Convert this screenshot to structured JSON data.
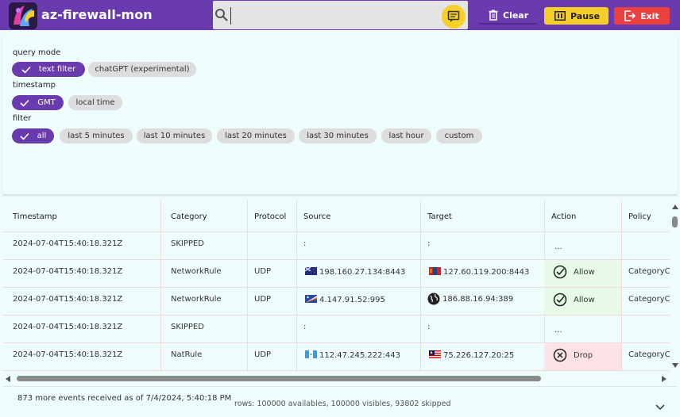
{
  "app": {
    "title": "az-firewall-mon"
  },
  "search": {
    "value": "",
    "placeholder": ""
  },
  "toolbar": {
    "clear_label": "Clear",
    "pause_label": "Pause",
    "exit_label": "Exit"
  },
  "filters": {
    "query_mode": {
      "label": "query mode",
      "options": [
        "text filter",
        "chatGPT (experimental)"
      ],
      "selected": "text filter"
    },
    "timestamp": {
      "label": "timestamp",
      "options": [
        "GMT",
        "local time"
      ],
      "selected": "GMT"
    },
    "filter": {
      "label": "filter",
      "options": [
        "all",
        "last 5 minutes",
        "last 10 minutes",
        "last 20 minutes",
        "last 30 minutes",
        "last hour",
        "custom"
      ],
      "selected": "all"
    }
  },
  "table": {
    "columns": [
      "Timestamp",
      "Category",
      "Protocol",
      "Source",
      "Target",
      "Action",
      "Policy"
    ],
    "rows": [
      {
        "timestamp": "2024-07-04T15:40:18.321Z",
        "category": "SKIPPED",
        "protocol": "",
        "source": ":",
        "source_flag": "",
        "target": ":",
        "target_flag": "",
        "action": "...",
        "action_icon": "",
        "policy": ""
      },
      {
        "timestamp": "2024-07-04T15:40:18.321Z",
        "category": "NetworkRule",
        "protocol": "UDP",
        "source": "198.160.27.134:8443",
        "source_flag": "flag-nz-icon",
        "target": "127.60.119.200:8443",
        "target_flag": "flag-mn-icon",
        "action": "Allow",
        "action_icon": "check-circle-icon",
        "policy": "CategoryC"
      },
      {
        "timestamp": "2024-07-04T15:40:18.321Z",
        "category": "NetworkRule",
        "protocol": "UDP",
        "source": "4.147.91.52:995",
        "source_flag": "flag-mh-icon",
        "target": "186.88.16.94:389",
        "target_flag": "globe-icon",
        "action": "Allow",
        "action_icon": "check-circle-icon",
        "policy": "CategoryC"
      },
      {
        "timestamp": "2024-07-04T15:40:18.321Z",
        "category": "SKIPPED",
        "protocol": "",
        "source": ":",
        "source_flag": "",
        "target": ":",
        "target_flag": "",
        "action": "...",
        "action_icon": "",
        "policy": ""
      },
      {
        "timestamp": "2024-07-04T15:40:18.321Z",
        "category": "NatRule",
        "protocol": "UDP",
        "source": "112.47.245.222:443",
        "source_flag": "flag-gt-icon",
        "target": "75.226.127.20:25",
        "target_flag": "flag-my-icon",
        "action": "Drop",
        "action_icon": "x-circle-icon",
        "policy": "CategoryC"
      }
    ]
  },
  "footer": {
    "message": "873 more events received as of 7/4/2024, 5:40:18 PM",
    "stats": "rows: 100000 availables, 100000 visibles, 93802 skipped"
  },
  "colors": {
    "accent": "#6a3aaf",
    "pause": "#f7cf2a",
    "exit": "#e94040",
    "allow_bg": "#e7fae8",
    "drop_bg": "#fde3e8",
    "background": "#eefdfb"
  }
}
